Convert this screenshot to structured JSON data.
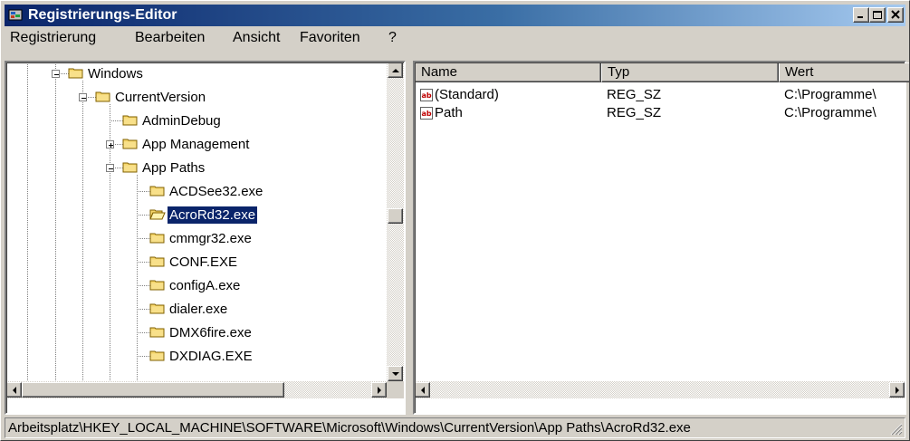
{
  "window": {
    "title": "Registrierungs-Editor",
    "icon": "regedit-icon"
  },
  "menu": [
    "Registrierung",
    "Bearbeiten",
    "Ansicht",
    "Favoriten",
    "?"
  ],
  "tree": {
    "nodes": [
      {
        "label": "Windows",
        "expander": "minus"
      },
      {
        "label": "CurrentVersion",
        "expander": "minus"
      },
      {
        "label": "AdminDebug",
        "expander": "none"
      },
      {
        "label": "App Management",
        "expander": "plus"
      },
      {
        "label": "App Paths",
        "expander": "minus"
      },
      {
        "label": "ACDSee32.exe",
        "expander": "none"
      },
      {
        "label": "AcroRd32.exe",
        "expander": "none",
        "selected": true
      },
      {
        "label": "cmmgr32.exe",
        "expander": "none"
      },
      {
        "label": "CONF.EXE",
        "expander": "none"
      },
      {
        "label": "configA.exe",
        "expander": "none"
      },
      {
        "label": "dialer.exe",
        "expander": "none"
      },
      {
        "label": "DMX6fire.exe",
        "expander": "none"
      },
      {
        "label": "DXDIAG.EXE",
        "expander": "none"
      }
    ],
    "vertical_scroll_position": 0.48,
    "horizontal_scroll_position": 0.0
  },
  "list": {
    "columns": [
      "Name",
      "Typ",
      "Wert"
    ],
    "rows": [
      {
        "icon": "string-value-icon",
        "name": "(Standard)",
        "type": "REG_SZ",
        "value": "C:\\Programme\\"
      },
      {
        "icon": "string-value-icon",
        "name": "Path",
        "type": "REG_SZ",
        "value": "C:\\Programme\\"
      }
    ]
  },
  "status": {
    "path": "Arbeitsplatz\\HKEY_LOCAL_MACHINE\\SOFTWARE\\Microsoft\\Windows\\CurrentVersion\\App Paths\\AcroRd32.exe"
  },
  "colors": {
    "title_gradient_start": "#0a246a",
    "title_gradient_end": "#a6caf0",
    "selection": "#0a246a",
    "face": "#d4d0c8",
    "folder": "#f6d66b"
  }
}
